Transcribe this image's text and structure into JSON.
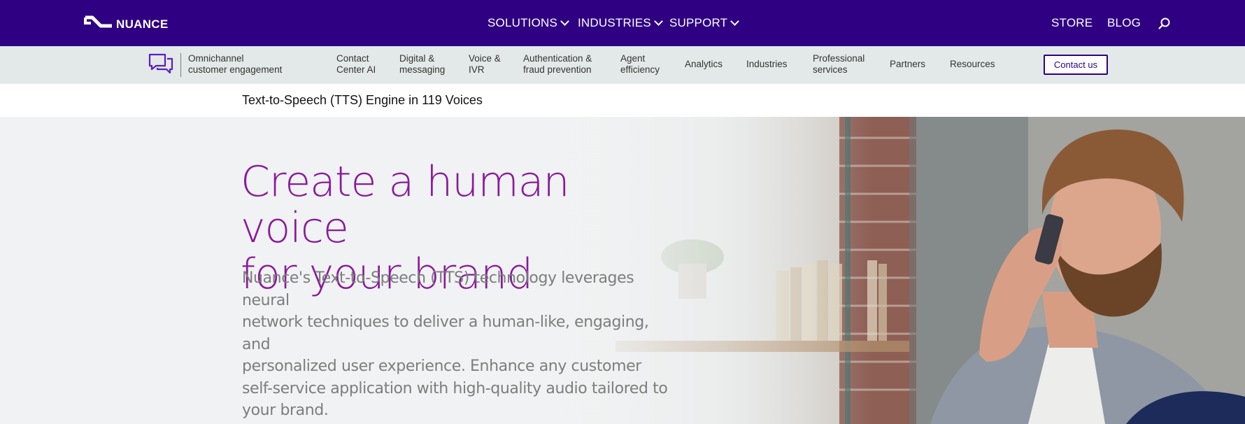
{
  "brand": {
    "name": "NUANCE"
  },
  "top_nav": {
    "main": [
      {
        "label": "SOLUTIONS"
      },
      {
        "label": "INDUSTRIES"
      },
      {
        "label": "SUPPORT"
      }
    ],
    "right": [
      {
        "label": "STORE"
      },
      {
        "label": "BLOG"
      }
    ],
    "search_icon": "search-icon"
  },
  "sub_nav": {
    "product": {
      "line1": "Omnichannel",
      "line2": "customer engagement"
    },
    "items": [
      {
        "line1": "Contact",
        "line2": "Center AI"
      },
      {
        "line1": "Digital &",
        "line2": "messaging"
      },
      {
        "line1": "Voice &",
        "line2": "IVR"
      },
      {
        "line1": "Authentication &",
        "line2": "fraud prevention"
      },
      {
        "line1": "Agent",
        "line2": "efficiency"
      },
      {
        "line1": "Analytics"
      },
      {
        "line1": "Industries"
      },
      {
        "line1": "Professional",
        "line2": "services"
      },
      {
        "line1": "Partners"
      },
      {
        "line1": "Resources"
      }
    ],
    "cta": "Contact us"
  },
  "page_title": "Text-to-Speech (TTS) Engine in 119 Voices",
  "hero": {
    "heading_line1": "Create a human voice",
    "heading_line2": "for your brand",
    "body_lines": [
      "Nuance's Text-to-Speech (TTS) technology leverages neural",
      "network techniques to deliver a human-like, engaging, and",
      "personalized user experience. Enhance any customer",
      "self-service application with high-quality audio tailored to",
      "your brand."
    ]
  },
  "colors": {
    "top_bar": "#2f0082",
    "sub_bar": "#e3e9e8",
    "heading": "#8a1a9b",
    "body_text": "#7d7d7d"
  }
}
